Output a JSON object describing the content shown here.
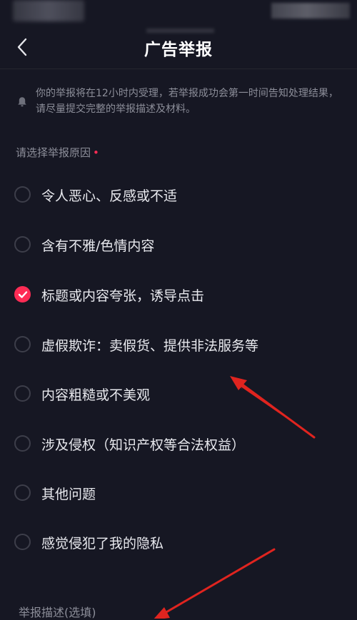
{
  "header": {
    "title": "广告举报",
    "back_icon": "chevron-left-icon"
  },
  "notice": {
    "icon": "bell-icon",
    "text": "你的举报将在12小时内受理，若举报成功会第一时间告知处理结果，请尽量提交完整的举报描述及材料。"
  },
  "reason_section": {
    "label": "请选择举报原因",
    "required_mark": "•",
    "options": [
      {
        "label": "令人恶心、反感或不适",
        "checked": false
      },
      {
        "label": "含有不雅/色情内容",
        "checked": false
      },
      {
        "label": "标题或内容夸张，诱导点击",
        "checked": true
      },
      {
        "label": "虚假欺诈：卖假货、提供非法服务等",
        "checked": false
      },
      {
        "label": "内容粗糙或不美观",
        "checked": false
      },
      {
        "label": "涉及侵权（知识产权等合法权益）",
        "checked": false
      },
      {
        "label": "其他问题",
        "checked": false
      },
      {
        "label": "感觉侵犯了我的隐私",
        "checked": false
      }
    ]
  },
  "description_section": {
    "label": "举报描述(选填)"
  },
  "colors": {
    "background": "#161723",
    "accent": "#fe2c55",
    "text_primary": "#e8e9ee",
    "text_secondary": "#8c8e99",
    "annotation": "#e0241f"
  }
}
